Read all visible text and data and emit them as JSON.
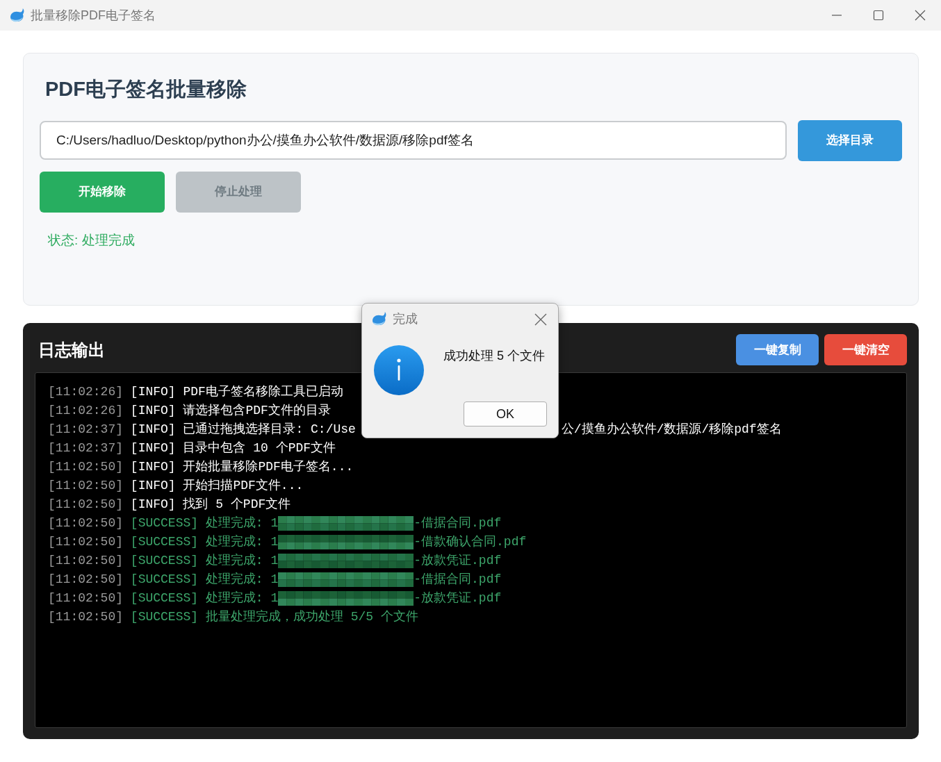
{
  "window": {
    "title": "批量移除PDF电子签名"
  },
  "header": {
    "title": "PDF电子签名批量移除",
    "directory": {
      "value": "C:/Users/hadluo/Desktop/python办公/摸鱼办公软件/数据源/移除pdf签名"
    },
    "choose_button": {
      "label": "选择目录"
    },
    "actions": [
      {
        "label": "开始移除",
        "kind": "start",
        "disabled": false
      },
      {
        "label": "停止处理",
        "kind": "stop",
        "disabled": true
      }
    ],
    "status": {
      "text": "状态: 处理完成",
      "kind": "success"
    }
  },
  "log": {
    "title": "日志输出",
    "buttons": [
      {
        "label": "一键复制",
        "kind": "copy"
      },
      {
        "label": "一键清空",
        "kind": "clear"
      }
    ],
    "lines": [
      {
        "time": "[11:02:26]",
        "level": "[INFO]",
        "kind": "info",
        "text": "PDF电子签名移除工具已启动"
      },
      {
        "time": "[11:02:26]",
        "level": "[INFO]",
        "kind": "info",
        "text": "请选择包含PDF文件的目录"
      },
      {
        "time": "[11:02:37]",
        "level": "[INFO]",
        "kind": "info",
        "text": "已通过拖拽选择目录: C:/Use",
        "covered": true,
        "text_after": "公/摸鱼办公软件/数据源/移除pdf签名"
      },
      {
        "time": "[11:02:37]",
        "level": "[INFO]",
        "kind": "info",
        "text": "目录中包含 10 个PDF文件"
      },
      {
        "time": "[11:02:50]",
        "level": "[INFO]",
        "kind": "info",
        "text": "开始批量移除PDF电子签名..."
      },
      {
        "time": "[11:02:50]",
        "level": "[INFO]",
        "kind": "info",
        "text": "开始扫描PDF文件..."
      },
      {
        "time": "[11:02:50]",
        "level": "[INFO]",
        "kind": "info",
        "text": "找到 5 个PDF文件"
      },
      {
        "time": "[11:02:50]",
        "level": "[SUCCESS]",
        "kind": "success",
        "text": "处理完成: 1",
        "redacted": true,
        "text_after": "-借据合同.pdf"
      },
      {
        "time": "[11:02:50]",
        "level": "[SUCCESS]",
        "kind": "success",
        "text": "处理完成: 1",
        "redacted": true,
        "text_after": "-借款确认合同.pdf"
      },
      {
        "time": "[11:02:50]",
        "level": "[SUCCESS]",
        "kind": "success",
        "text": "处理完成: 1",
        "redacted": true,
        "text_after": "-放款凭证.pdf"
      },
      {
        "time": "[11:02:50]",
        "level": "[SUCCESS]",
        "kind": "success",
        "text": "处理完成: 1",
        "redacted": true,
        "text_after": "-借据合同.pdf"
      },
      {
        "time": "[11:02:50]",
        "level": "[SUCCESS]",
        "kind": "success",
        "text": "处理完成: 1",
        "redacted": true,
        "text_after": "-放款凭证.pdf"
      },
      {
        "time": "[11:02:50]",
        "level": "[SUCCESS]",
        "kind": "success",
        "text": "批量处理完成，成功处理 5/5 个文件"
      }
    ]
  },
  "dialog": {
    "title": "完成",
    "message": "成功处理 5 个文件",
    "button": "OK"
  }
}
